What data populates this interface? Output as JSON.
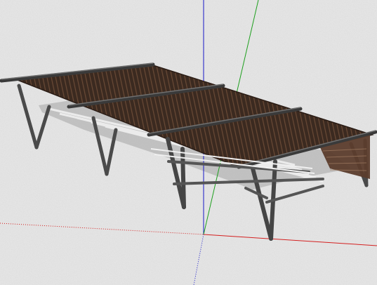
{
  "viewport": {
    "background_color": "#e8e8e8",
    "axis_colors": {
      "red": "#d42020",
      "green": "#1ea01e",
      "blue": "#1818c8"
    }
  },
  "model": {
    "subject": "pergola-canopy",
    "deck_color": "#3b2a20",
    "slat_color": "#6a4a36",
    "beam_color": "#3a3a3a",
    "post_color": "#4a4a4a",
    "shadow_color": "#b8b8b8"
  }
}
